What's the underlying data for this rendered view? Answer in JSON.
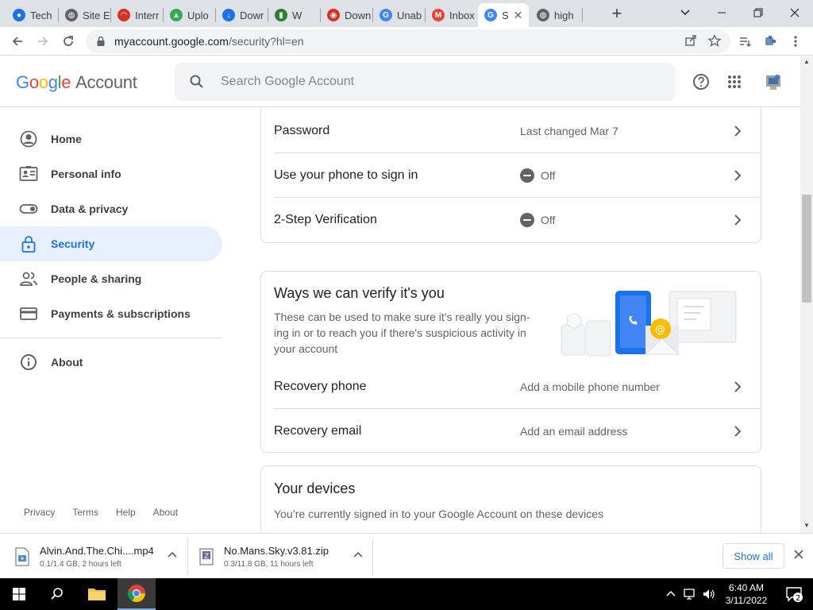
{
  "browser": {
    "tabs": [
      {
        "title": "Tech",
        "favicon": "logo-icon",
        "color": "#1a73e8"
      },
      {
        "title": "Site E",
        "favicon": "globe-icon",
        "color": "#5f6368"
      },
      {
        "title": "Interr",
        "favicon": "wifi-icon",
        "color": "#d93025"
      },
      {
        "title": "Uplo",
        "favicon": "upload-icon",
        "color": "#34a853"
      },
      {
        "title": "Dowr",
        "favicon": "download-icon",
        "color": "#1a73e8"
      },
      {
        "title": "W",
        "favicon": "app-icon",
        "color": "#2e7d32"
      },
      {
        "title": "Down",
        "favicon": "mask-icon",
        "color": "#d93025"
      },
      {
        "title": "Unab",
        "favicon": "google-icon",
        "color": "#4285f4"
      },
      {
        "title": "Inbox",
        "favicon": "gmail-icon",
        "color": "#ea4335"
      },
      {
        "title": "S",
        "favicon": "google-icon",
        "color": "#4285f4",
        "active": true
      },
      {
        "title": "high",
        "favicon": "globe-icon",
        "color": "#5f6368"
      }
    ],
    "url_host": "myaccount.google.com",
    "url_path": "/security?hl=en"
  },
  "header": {
    "logo_letters": [
      "G",
      "o",
      "o",
      "g",
      "l",
      "e"
    ],
    "logo_suffix": "Account",
    "search_placeholder": "Search Google Account"
  },
  "nav": {
    "items": [
      {
        "label": "Home",
        "icon": "account-circle-icon"
      },
      {
        "label": "Personal info",
        "icon": "id-card-icon"
      },
      {
        "label": "Data & privacy",
        "icon": "toggle-icon"
      },
      {
        "label": "Security",
        "icon": "lock-icon",
        "active": true
      },
      {
        "label": "People & sharing",
        "icon": "people-icon"
      },
      {
        "label": "Payments & subscriptions",
        "icon": "credit-card-icon"
      }
    ],
    "about": {
      "label": "About",
      "icon": "info-icon"
    },
    "footer": [
      "Privacy",
      "Terms",
      "Help",
      "About"
    ]
  },
  "signin_card": {
    "rows": [
      {
        "label": "Password",
        "value": "Last changed Mar 7"
      },
      {
        "label": "Use your phone to sign in",
        "value": "Off",
        "status_icon": "off-icon"
      },
      {
        "label": "2-Step Verification",
        "value": "Off",
        "status_icon": "off-icon"
      }
    ]
  },
  "verify_card": {
    "title": "Ways we can verify it's you",
    "description": "These can be used to make sure it's really you sign-ing in or to reach you if there's suspicious activity in your account",
    "desc_lines": [
      "These can be used to make sure it's really you sign-",
      "ing in or to reach you if there's suspicious activity in",
      "your account"
    ],
    "rows": [
      {
        "label": "Recovery phone",
        "value": "Add a mobile phone number"
      },
      {
        "label": "Recovery email",
        "value": "Add an email address"
      }
    ]
  },
  "devices_card": {
    "title": "Your devices",
    "description": "You’re currently signed in to your Google Account on these devices"
  },
  "downloads": {
    "items": [
      {
        "name": "Alvin.And.The.Chi....mp4",
        "status": "0.1/1.4 GB, 2 hours left"
      },
      {
        "name": "No.Mans.Sky.v3.81.zip",
        "status": "0.3/11.8 GB, 11 hours left"
      }
    ],
    "show_all": "Show all"
  },
  "taskbar": {
    "time": "6:40 AM",
    "date": "3/11/2022",
    "notifications": "2"
  },
  "colors": {
    "accent": "#1a73e8",
    "nav_active_bg": "#e8f0fe"
  }
}
